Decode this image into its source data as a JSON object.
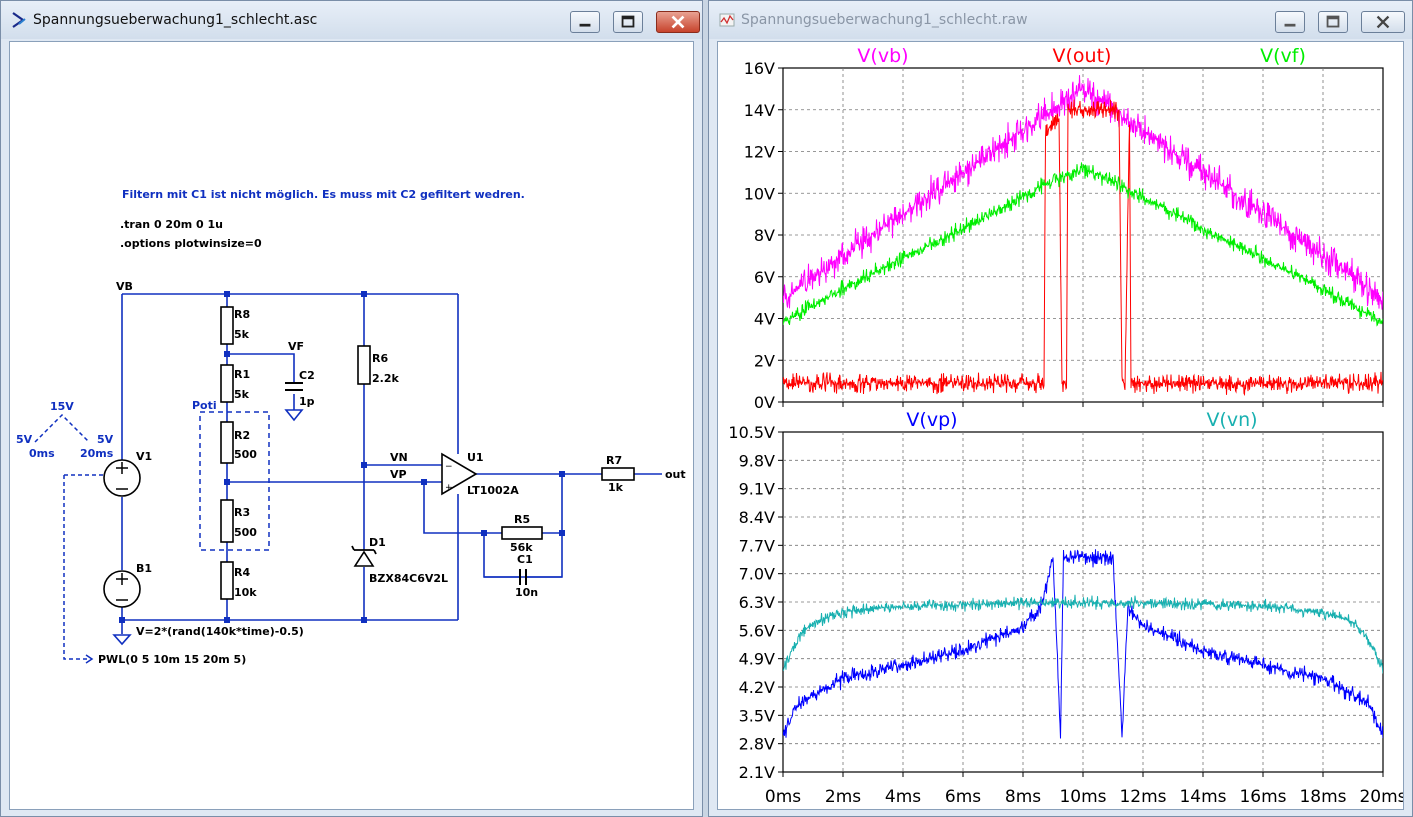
{
  "left_window": {
    "title": "Spannungsueberwachung1_schlecht.asc",
    "schematic": {
      "comment": "Filtern mit C1 ist nicht möglich. Es muss mit C2 gefiltert wedren.",
      "directive_tran": ".tran 0 20m 0 1u",
      "directive_options": ".options plotwinsize=0",
      "net_vb": "VB",
      "net_vf": "VF",
      "net_vn": "VN",
      "net_vp": "VP",
      "net_out": "out",
      "poti_label": "Poti",
      "pwl_15v": "15V",
      "pwl_5v_left": "5V",
      "pwl_0ms": "0ms",
      "pwl_5v_right": "5V",
      "pwl_20ms": "20ms",
      "components": {
        "r8": {
          "name": "R8",
          "value": "5k"
        },
        "r1": {
          "name": "R1",
          "value": "5k"
        },
        "r2": {
          "name": "R2",
          "value": "500"
        },
        "r3": {
          "name": "R3",
          "value": "500"
        },
        "r4": {
          "name": "R4",
          "value": "10k"
        },
        "r6": {
          "name": "R6",
          "value": "2.2k"
        },
        "r5": {
          "name": "R5",
          "value": "56k"
        },
        "r7": {
          "name": "R7",
          "value": "1k"
        },
        "c1": {
          "name": "C1",
          "value": "10n"
        },
        "c2": {
          "name": "C2",
          "value": "1p"
        },
        "v1": {
          "name": "V1"
        },
        "b1": {
          "name": "B1",
          "value": "V=2*(rand(140k*time)-0.5)"
        },
        "d1": {
          "name": "D1",
          "value": "BZX84C6V2L"
        },
        "u1": {
          "name": "U1",
          "value": "LT1002A"
        },
        "v1_value": "PWL(0 5 10m 15 20m 5)"
      }
    }
  },
  "right_window": {
    "title": "Spannungsueberwachung1_schlecht.raw"
  },
  "colors": {
    "vb": "#ff00ff",
    "out": "#ff0000",
    "vf": "#00ee00",
    "vp": "#0000ff",
    "vn": "#18b0b0",
    "wire": "#1030c0"
  },
  "chart_data": [
    {
      "type": "line",
      "x_unit": "ms",
      "x_ticks": [
        "0ms",
        "2ms",
        "4ms",
        "6ms",
        "8ms",
        "10ms",
        "12ms",
        "14ms",
        "16ms",
        "18ms",
        "20ms"
      ],
      "xlim": [
        0,
        20
      ],
      "y_ticks": [
        "0V",
        "2V",
        "4V",
        "6V",
        "8V",
        "10V",
        "12V",
        "14V",
        "16V"
      ],
      "ylim": [
        0,
        16
      ],
      "grid": true,
      "series": [
        {
          "name": "V(vb)",
          "color": "#ff00ff",
          "x": [
            0,
            2,
            4,
            6,
            8,
            9,
            10,
            11,
            12,
            14,
            16,
            18,
            20
          ],
          "y": [
            5,
            7,
            9,
            11,
            13,
            14,
            15,
            14,
            13,
            11,
            9,
            7,
            5
          ],
          "noise": 1.0
        },
        {
          "name": "V(out)",
          "color": "#ff0000",
          "x": [
            0,
            8.7,
            8.75,
            9.2,
            9.3,
            9.45,
            9.5,
            11.2,
            11.3,
            11.4,
            11.55,
            11.6,
            20
          ],
          "y": [
            0.9,
            0.9,
            13,
            13.5,
            0.9,
            0.9,
            14,
            14,
            0.9,
            0.9,
            13.5,
            0.9,
            0.9
          ],
          "noise": 0.6
        },
        {
          "name": "V(vf)",
          "color": "#00ee00",
          "x": [
            0,
            2,
            4,
            6,
            8,
            9,
            10,
            11,
            12,
            14,
            16,
            18,
            20
          ],
          "y": [
            3.8,
            5.4,
            6.9,
            8.3,
            9.8,
            10.6,
            11.2,
            10.6,
            9.8,
            8.3,
            6.9,
            5.4,
            3.8
          ],
          "noise": 0.5
        }
      ]
    },
    {
      "type": "line",
      "x_unit": "ms",
      "x_ticks": [
        "0ms",
        "2ms",
        "4ms",
        "6ms",
        "8ms",
        "10ms",
        "12ms",
        "14ms",
        "16ms",
        "18ms",
        "20ms"
      ],
      "xlim": [
        0,
        20
      ],
      "y_ticks": [
        "2.1V",
        "2.8V",
        "3.5V",
        "4.2V",
        "4.9V",
        "5.6V",
        "6.3V",
        "7.0V",
        "7.7V",
        "8.4V",
        "9.1V",
        "9.8V",
        "10.5V"
      ],
      "ylim": [
        2.1,
        10.5
      ],
      "grid": true,
      "series": [
        {
          "name": "V(vp)",
          "color": "#0000ff",
          "x": [
            0,
            0.5,
            2,
            4,
            6,
            8,
            8.6,
            9.0,
            9.25,
            9.35,
            9.5,
            10,
            11,
            11.3,
            11.5,
            12,
            14,
            16,
            18,
            19.5,
            20
          ],
          "y": [
            3.0,
            3.8,
            4.4,
            4.75,
            5.1,
            5.7,
            6.2,
            7.4,
            3.0,
            7.4,
            7.4,
            7.4,
            7.4,
            3.0,
            6.2,
            5.7,
            5.1,
            4.75,
            4.4,
            3.8,
            3.0
          ],
          "noise": 0.25
        },
        {
          "name": "V(vn)",
          "color": "#18b0b0",
          "x": [
            0,
            0.5,
            1,
            2,
            4,
            8,
            12,
            16,
            18,
            19,
            19.5,
            20
          ],
          "y": [
            4.6,
            5.4,
            5.8,
            6.05,
            6.2,
            6.28,
            6.28,
            6.2,
            6.05,
            5.8,
            5.4,
            4.6
          ],
          "noise": 0.2
        }
      ]
    }
  ]
}
